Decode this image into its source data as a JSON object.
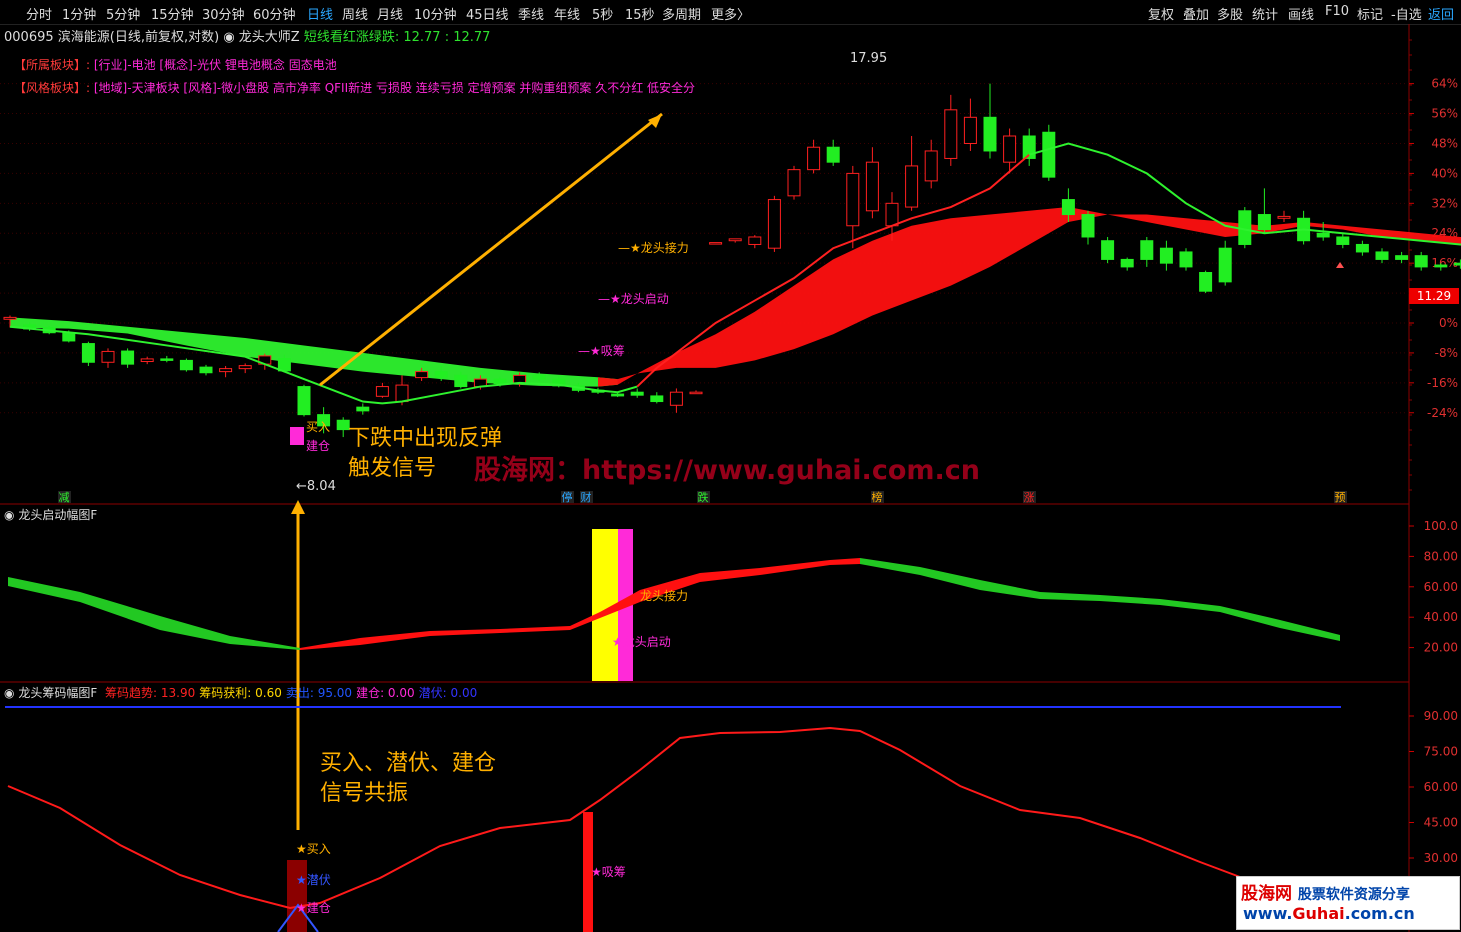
{
  "toolbar": {
    "periods": [
      "分时",
      "1分钟",
      "5分钟",
      "15分钟",
      "30分钟",
      "60分钟",
      "日线",
      "周线",
      "月线",
      "10分钟",
      "45日线",
      "季线",
      "年线",
      "5秒",
      "15秒",
      "多周期",
      "更多〉"
    ],
    "active_period": "日线",
    "right_items": [
      "复权",
      "叠加",
      "多股",
      "统计",
      "画线",
      "F10",
      "标记",
      "-自选",
      "返回"
    ],
    "active_right": "返回"
  },
  "header": {
    "code_name": "000695 滨海能源(日线,前复权,对数)",
    "indicator": "龙头大师Z",
    "legend": "短线看红涨绿跌: 12.77 : 12.77"
  },
  "sectors": {
    "row1_key": "【所属板块】:",
    "row1_val": "[行业]-电池 [概念]-光伏 锂电池概念 固态电池",
    "row2_key": "【风格板块】:",
    "row2_val": "[地域]-天津板块 [风格]-微小盘股 高市净率 QFII新进 亏损股 连续亏损 定增预案 并购重组预案 久不分红 低安全分"
  },
  "main_axis": {
    "labels": [
      "64%",
      "56%",
      "48%",
      "40%",
      "32%",
      "24%",
      "16%",
      "8%",
      "0%",
      "-8%",
      "-16%",
      "-24%"
    ],
    "current_price": "11.29"
  },
  "main_marks": {
    "high": "17.95",
    "low": "←8.04",
    "buy": "买入",
    "build": "建仓",
    "dragon_relay": "龙头接力",
    "dragon_start": "龙头启动",
    "absorb": "吸筹",
    "events": [
      "减",
      "停",
      "财",
      "跌",
      "榜",
      "涨",
      "预"
    ]
  },
  "annotations": {
    "a1": "下跌中出现反弹",
    "a2": "触发信号",
    "b1": "买入、潜伏、建仓",
    "b2": "信号共振",
    "watermark": "股海网：https://www.guhai.com.cn"
  },
  "panel2": {
    "title": "龙头启动幅图F",
    "axis": [
      "100.0",
      "80.00",
      "60.00",
      "40.00",
      "20.00"
    ],
    "relay": "龙头接力",
    "start": "龙头启动"
  },
  "panel3": {
    "title": "龙头筹码幅图F",
    "items": [
      {
        "label": "筹码趋势: 13.90",
        "color": "#ff2222"
      },
      {
        "label": "筹码获利: 0.60",
        "color": "#ffd700"
      },
      {
        "label": "卖出: 95.00",
        "color": "#2255ff"
      },
      {
        "label": "建仓: 0.00",
        "color": "#ff2ad8"
      },
      {
        "label": "潜伏: 0.00",
        "color": "#3333ff"
      }
    ],
    "axis": [
      "90.00",
      "75.00",
      "60.00",
      "45.00",
      "30.00"
    ],
    "buy": "★买入",
    "lurk": "★潜伏",
    "build": "★建仓",
    "absorb": "★吸筹"
  },
  "logo": {
    "name": "股海网",
    "slogan": "股票软件资源分享",
    "url_a": "www.",
    "url_b": "Guhai",
    "url_c": ".com.cn"
  },
  "chart_data": {
    "type": "candlestick",
    "title": "000695 滨海能源(日线,前复权,对数)",
    "price_high": 17.95,
    "price_low": 8.04,
    "price_current": 11.29,
    "y_axis_pct": [
      64,
      56,
      48,
      40,
      32,
      24,
      16,
      8,
      0,
      -8,
      -16,
      -24
    ],
    "candles": [
      [
        1.0,
        1.5,
        -1.2,
        2.0
      ],
      [
        -0.5,
        -1.6,
        -2.1,
        0.2
      ],
      [
        -1.2,
        -2.6,
        -3.0,
        -0.8
      ],
      [
        -2.6,
        -4.8,
        -5.2,
        -2.0
      ],
      [
        -5.5,
        -10.5,
        -11.5,
        -5.0
      ],
      [
        -10.5,
        -7.6,
        -12.0,
        -6.8
      ],
      [
        -7.5,
        -11.0,
        -12.0,
        -6.8
      ],
      [
        -10.3,
        -9.6,
        -11.0,
        -9.0
      ],
      [
        -9.6,
        -10.0,
        -10.5,
        -8.8
      ],
      [
        -10.0,
        -12.5,
        -13.0,
        -9.5
      ],
      [
        -11.8,
        -13.3,
        -14.0,
        -11.2
      ],
      [
        -13.0,
        -12.2,
        -14.5,
        -11.5
      ],
      [
        -12.2,
        -11.4,
        -13.4,
        -10.8
      ],
      [
        -11.0,
        -8.8,
        -12.5,
        -8.2
      ],
      [
        -9.5,
        -12.8,
        -13.2,
        -8.5
      ],
      [
        -17.0,
        -24.5,
        -25.0,
        -16.5
      ],
      [
        -24.5,
        -27.5,
        -29.5,
        -22.5
      ],
      [
        -26.0,
        -28.5,
        -30.5,
        -25.2
      ],
      [
        -22.5,
        -23.5,
        -24.5,
        -21.5
      ],
      [
        -19.6,
        -17.0,
        -20.0,
        -16.0
      ],
      [
        -21.0,
        -16.6,
        -22.0,
        -14.0
      ],
      [
        -14.6,
        -13.0,
        -15.5,
        -12.0
      ],
      [
        -13.0,
        -14.5,
        -15.5,
        -11.5
      ],
      [
        -14.0,
        -17.0,
        -17.5,
        -13.0
      ],
      [
        -17.0,
        -15.0,
        -17.8,
        -14.0
      ],
      [
        -15.0,
        -16.2,
        -17.0,
        -14.4
      ],
      [
        -16.2,
        -14.0,
        -17.0,
        -13.2
      ],
      [
        -14.0,
        -15.0,
        -15.6,
        -13.2
      ],
      [
        -15.0,
        -16.8,
        -17.2,
        -14.2
      ],
      [
        -16.8,
        -18.0,
        -18.5,
        -16.0
      ],
      [
        -18.0,
        -18.5,
        -19.0,
        -17.3
      ],
      [
        -19.0,
        -19.5,
        -19.8,
        -18.4
      ],
      [
        -18.5,
        -19.3,
        -20.0,
        -17.5
      ],
      [
        -19.5,
        -21.0,
        -21.5,
        -18.5
      ],
      [
        -22.0,
        -18.5,
        -24.0,
        -17.5
      ],
      [
        -18.5,
        -18.5,
        -19.0,
        -18.0
      ],
      [
        21.5,
        21.5,
        21.5,
        21.5
      ],
      [
        22.0,
        22.5,
        22.5,
        21.5
      ],
      [
        21.0,
        23.0,
        23.5,
        20.0
      ],
      [
        20.0,
        33.0,
        34.0,
        19.0
      ],
      [
        34.0,
        41.0,
        42.0,
        33.0
      ],
      [
        41.0,
        47.0,
        49.0,
        40.0
      ],
      [
        47.0,
        43.0,
        49.0,
        42.0
      ],
      [
        26.0,
        40.0,
        42.0,
        20.0
      ],
      [
        30.0,
        43.0,
        47.0,
        28.0
      ],
      [
        26.0,
        32.0,
        35.0,
        22.0
      ],
      [
        31.0,
        42.0,
        50.0,
        30.0
      ],
      [
        38.0,
        46.0,
        49.0,
        36.0
      ],
      [
        44.0,
        57.0,
        61.0,
        42.0
      ],
      [
        48.0,
        55.0,
        60.0,
        46.0
      ],
      [
        55.0,
        46.0,
        64.0,
        44.0
      ],
      [
        43.0,
        50.0,
        52.0,
        40.0
      ],
      [
        50.0,
        44.0,
        52.0,
        42.0
      ],
      [
        51.0,
        39.0,
        53.0,
        38.0
      ],
      [
        33.0,
        29.0,
        36.0,
        27.0
      ],
      [
        29.0,
        23.0,
        30.0,
        21.0
      ],
      [
        22.0,
        17.0,
        23.0,
        16.0
      ],
      [
        17.0,
        15.0,
        17.5,
        14.0
      ],
      [
        22.0,
        17.0,
        23.0,
        15.0
      ],
      [
        20.0,
        16.0,
        22.0,
        14.0
      ],
      [
        19.0,
        15.0,
        20.0,
        14.0
      ],
      [
        13.5,
        8.5,
        14.0,
        8.0
      ],
      [
        20.0,
        11.0,
        22.0,
        10.0
      ],
      [
        30.0,
        21.0,
        31.0,
        20.0
      ],
      [
        29.0,
        25.0,
        36.0,
        24.0
      ],
      [
        28.0,
        28.5,
        30.0,
        27.0
      ],
      [
        28.0,
        22.0,
        30.0,
        21.0
      ],
      [
        24.0,
        23.0,
        27.0,
        22.0
      ],
      [
        23.0,
        21.0,
        24.0,
        20.0
      ],
      [
        21.0,
        19.0,
        22.0,
        18.0
      ],
      [
        19.0,
        17.0,
        20.0,
        16.0
      ],
      [
        18.0,
        17.0,
        19.0,
        16.0
      ],
      [
        18.0,
        15.0,
        19.0,
        14.0
      ],
      [
        15.5,
        15.0,
        16.0,
        14.0
      ],
      [
        16.0,
        15.5,
        17.0,
        14.5
      ],
      [
        15.5,
        15.0,
        16.0,
        14.0
      ],
      [
        15.0,
        14.0,
        16.0,
        13.0
      ],
      [
        14.0,
        13.5,
        15.0,
        12.5
      ],
      [
        14.0,
        13.0,
        16.0,
        13.0
      ],
      [
        13.5,
        12.5,
        14.0,
        11.5
      ]
    ]
  }
}
